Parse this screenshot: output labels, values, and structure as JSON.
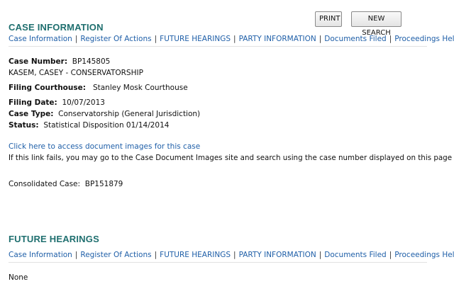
{
  "buttons": {
    "print": "PRINT",
    "new_search": "NEW SEARCH"
  },
  "nav": [
    "Case Information",
    "Register Of Actions",
    "FUTURE HEARINGS",
    "PARTY INFORMATION",
    "Documents Filed",
    "Proceedings Held"
  ],
  "nav_separator": "|",
  "case_info": {
    "title": "CASE INFORMATION",
    "case_number_label": "Case Number:",
    "case_number": "BP145805",
    "case_name": "KASEM, CASEY - CONSERVATORSHIP",
    "courthouse_label": "Filing Courthouse:",
    "courthouse": "Stanley Mosk Courthouse",
    "filing_date_label": "Filing Date:",
    "filing_date": "10/07/2013",
    "case_type_label": "Case Type:",
    "case_type": "Conservatorship (General Jurisdiction)",
    "status_label": "Status:",
    "status": "Statistical Disposition 01/14/2014",
    "doc_images_link": "Click here to access document images for this case",
    "doc_images_note": "If this link fails, you may go to the Case Document Images site and search using the case number displayed on this page",
    "consolidated_label": "Consolidated Case:",
    "consolidated_case": "BP151879"
  },
  "future_hearings": {
    "title": "FUTURE HEARINGS",
    "value": "None"
  }
}
